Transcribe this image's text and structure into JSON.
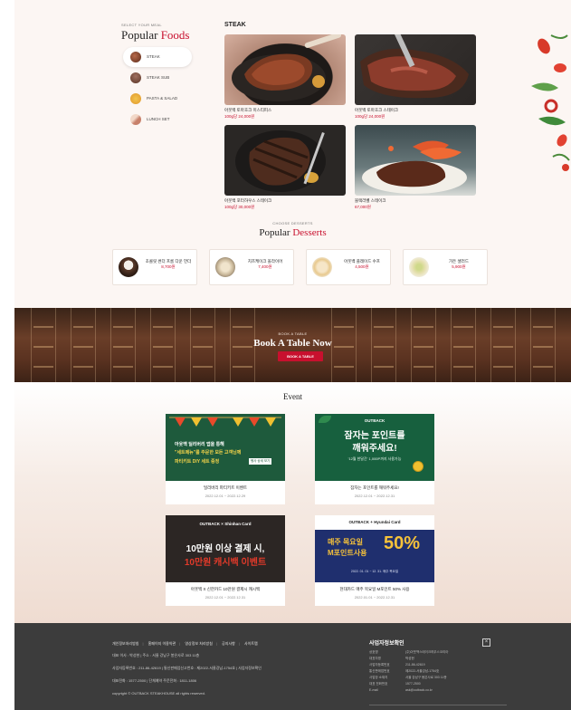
{
  "foods": {
    "caption": "SELECT YOUR MEAL",
    "title_main": "Popular",
    "title_accent": "Foods",
    "menu": [
      {
        "label": "STEAK",
        "icon": "steak-icon",
        "active": true
      },
      {
        "label": "STEAK SUB",
        "icon": "cloche-icon"
      },
      {
        "label": "PASTA & SALAD",
        "icon": "pasta-icon"
      },
      {
        "label": "LUNCH SET",
        "icon": "lunch-icon"
      }
    ],
    "category_heading": "STEAK",
    "items": [
      {
        "name": "아웃백 토마호크 미스티피스",
        "price": "100g당 24,000원"
      },
      {
        "name": "아웃백 토마호크 스테이크",
        "price": "100g당 24,000원"
      },
      {
        "name": "아웃백 포터하우스 스테이크",
        "price": "100g당 30,000원"
      },
      {
        "name": "블랙라벨 스테이크",
        "price": "67,000원"
      }
    ]
  },
  "desserts": {
    "caption": "CHOOSE DESSERTS",
    "title_main": "Popular",
    "title_accent": "Desserts",
    "items": [
      {
        "name": "초콜릿 썬더 프롬 다운 언더",
        "price": "8,700원"
      },
      {
        "name": "치즈케이크 올라이어",
        "price": "7,400원"
      },
      {
        "name": "아웃백 플레이드 수프",
        "price": "4,500원"
      },
      {
        "name": "가든 샐러드",
        "price": "5,900원"
      }
    ]
  },
  "booking": {
    "caption": "BOOK A TABLE",
    "title": "Book A Table Now",
    "button": "BOOK A TABLE"
  },
  "event": {
    "title": "Event",
    "cards": [
      {
        "name": "딜리버리 파티키트 이벤트",
        "date": "2022.12.01 ~ 2022.12.29",
        "line1": "아웃백 딜리버리 앱을 통해",
        "line2": "\"세트메뉴\"를 주문한 모든 고객님께",
        "line3": "파티키트 DIY 세트 증정",
        "tag": "행사 상세 보기"
      },
      {
        "name": "잠자는 포인트를 깨워주세요!",
        "date": "2022.12.01 ~ 2022.12.31",
        "brand": "OUTBACK",
        "line1": "잠자는 포인트를",
        "line2": "깨워주세요!",
        "line3": "'12월 한달간' 1,000P까지 사용가능"
      },
      {
        "name": "아웃백 X 신한카드 10만원 결제시 캐시백",
        "date": "2022.12.01 ~ 2022.12.31",
        "brand": "OUTBACK",
        "partner": "Shinhan Card",
        "line1": "10만원 이상 결제 시,",
        "line2": "10만원 캐시백 이벤트"
      },
      {
        "name": "현대카드 매주 목요일 M포인트 50% 사용",
        "date": "2022.01.01 ~ 2022.12.31",
        "brand": "OUTBACK",
        "partner": "Hyundai Card",
        "line1": "매주 목요일",
        "line2": "M포인트사용",
        "pct": "50%",
        "line3": "2022. 01. 01 ~ 12. 31. 매주 목요일"
      }
    ]
  },
  "footer": {
    "links": [
      "개인정보처리방침",
      "홈페이지 이용약관",
      "영상정보 처리방침",
      "공지사항",
      "사이트맵"
    ],
    "line2": "대표 이사 : 박성현 | 주소 : 서울 강남구 봉은사로 303 11층",
    "line3": "사업자등록번호 : 211-86-42619 | 통신판매업신고번호 : 제2022-서울강남-1754호 | 사업자정보확인",
    "line4": "대표전화 : 1577-2500 | 단체예약 주문전화 : 1811-1806",
    "copyright": "copyright © OUTBACK STEAKHOUSE all rights reserved.",
    "biz": {
      "title": "사업자정보확인",
      "close": "×",
      "rows": [
        [
          "상호명",
          "(주)아웃백스테이크하우스코리아"
        ],
        [
          "대표자명",
          "박성현"
        ],
        [
          "사업자등록번호",
          "211-86-42619"
        ],
        [
          "통신판매업번호",
          "제2022-서울강남-1754호"
        ],
        [
          "사업장 소재지",
          "서울 강남구 봉은사로 303 11층"
        ],
        [
          "대표 전화번호",
          "1577-2500"
        ],
        [
          "E-mail",
          "ask@outback.co.kr"
        ]
      ]
    }
  }
}
